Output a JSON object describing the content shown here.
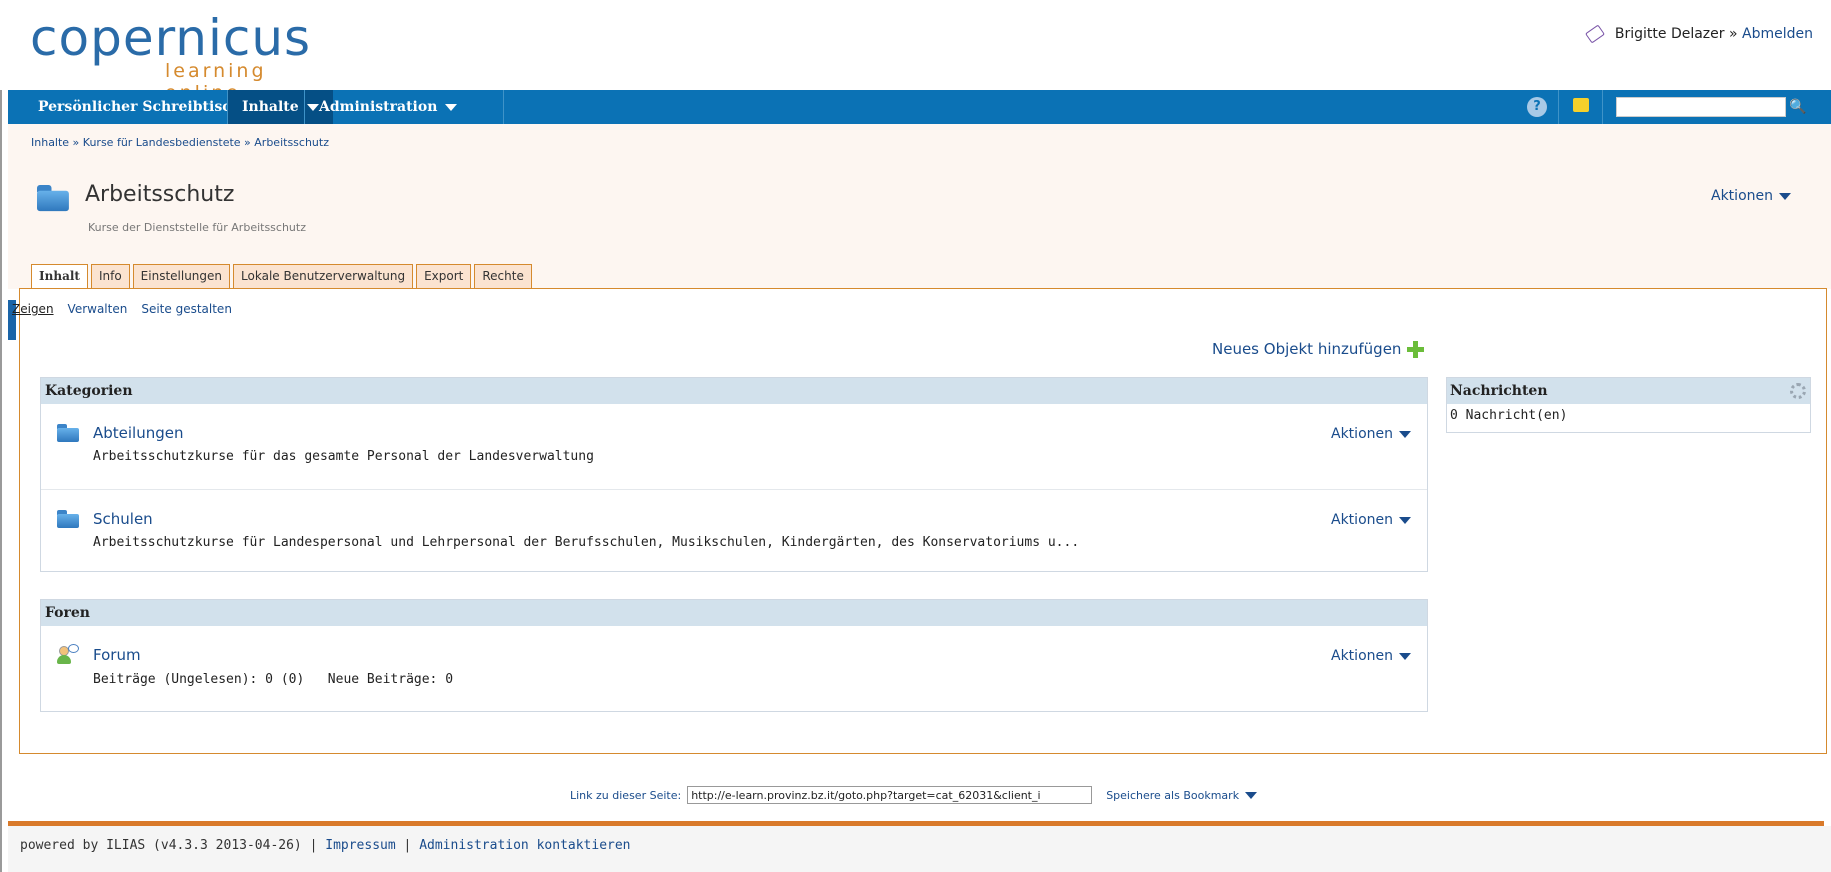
{
  "header": {
    "logo_main": "copernicus",
    "logo_sub": "learning online",
    "user_name": "Brigitte Delazer",
    "user_separator": "»",
    "logout_label": "Abmelden"
  },
  "nav": {
    "items": [
      {
        "label": "Persönlicher Schreibtisch"
      },
      {
        "label": "Inhalte"
      },
      {
        "label": "Administration"
      }
    ],
    "help_label": "?",
    "search_placeholder": ""
  },
  "breadcrumb": "Inhalte » Kurse für Landesbedienstete » Arbeitsschutz",
  "page": {
    "title": "Arbeitsschutz",
    "description": "Kurse der Dienststelle für Arbeitsschutz",
    "actions_label": "Aktionen"
  },
  "tabs": [
    {
      "label": "Inhalt"
    },
    {
      "label": "Info"
    },
    {
      "label": "Einstellungen"
    },
    {
      "label": "Lokale Benutzerverwaltung"
    },
    {
      "label": "Export"
    },
    {
      "label": "Rechte"
    }
  ],
  "subtabs": [
    {
      "label": "Zeigen"
    },
    {
      "label": "Verwalten"
    },
    {
      "label": "Seite gestalten"
    }
  ],
  "new_object_label": "Neues Objekt hinzufügen",
  "categories": {
    "heading": "Kategorien",
    "items": [
      {
        "title": "Abteilungen",
        "description": "Arbeitsschutzkurse für das gesamte Personal der Landesverwaltung",
        "actions": "Aktionen"
      },
      {
        "title": "Schulen",
        "description": "Arbeitsschutzkurse für Landespersonal und Lehrpersonal der Berufsschulen, Musikschulen, Kindergärten, des Konservatoriums u...",
        "actions": "Aktionen"
      }
    ]
  },
  "forums": {
    "heading": "Foren",
    "items": [
      {
        "title": "Forum",
        "description": "Beiträge (Ungelesen): 0 (0)   Neue Beiträge: 0",
        "actions": "Aktionen"
      }
    ]
  },
  "news": {
    "heading": "Nachrichten",
    "body": "0 Nachricht(en)"
  },
  "permalink": {
    "label": "Link zu dieser Seite:",
    "value": "http://e-learn.provinz.bz.it/goto.php?target=cat_62031&client_i",
    "bookmark_label": "Speichere als Bookmark"
  },
  "footer": {
    "powered": "powered by ILIAS (v4.3.3 2013-04-26) |",
    "impressum": "Impressum",
    "sep": "|",
    "contact": "Administration kontaktieren"
  },
  "colors": {
    "nav_blue": "#0b72b5",
    "accent_orange": "#d97a2a",
    "link_blue": "#1a4c8c",
    "panel_header": "#d2e1ec"
  }
}
